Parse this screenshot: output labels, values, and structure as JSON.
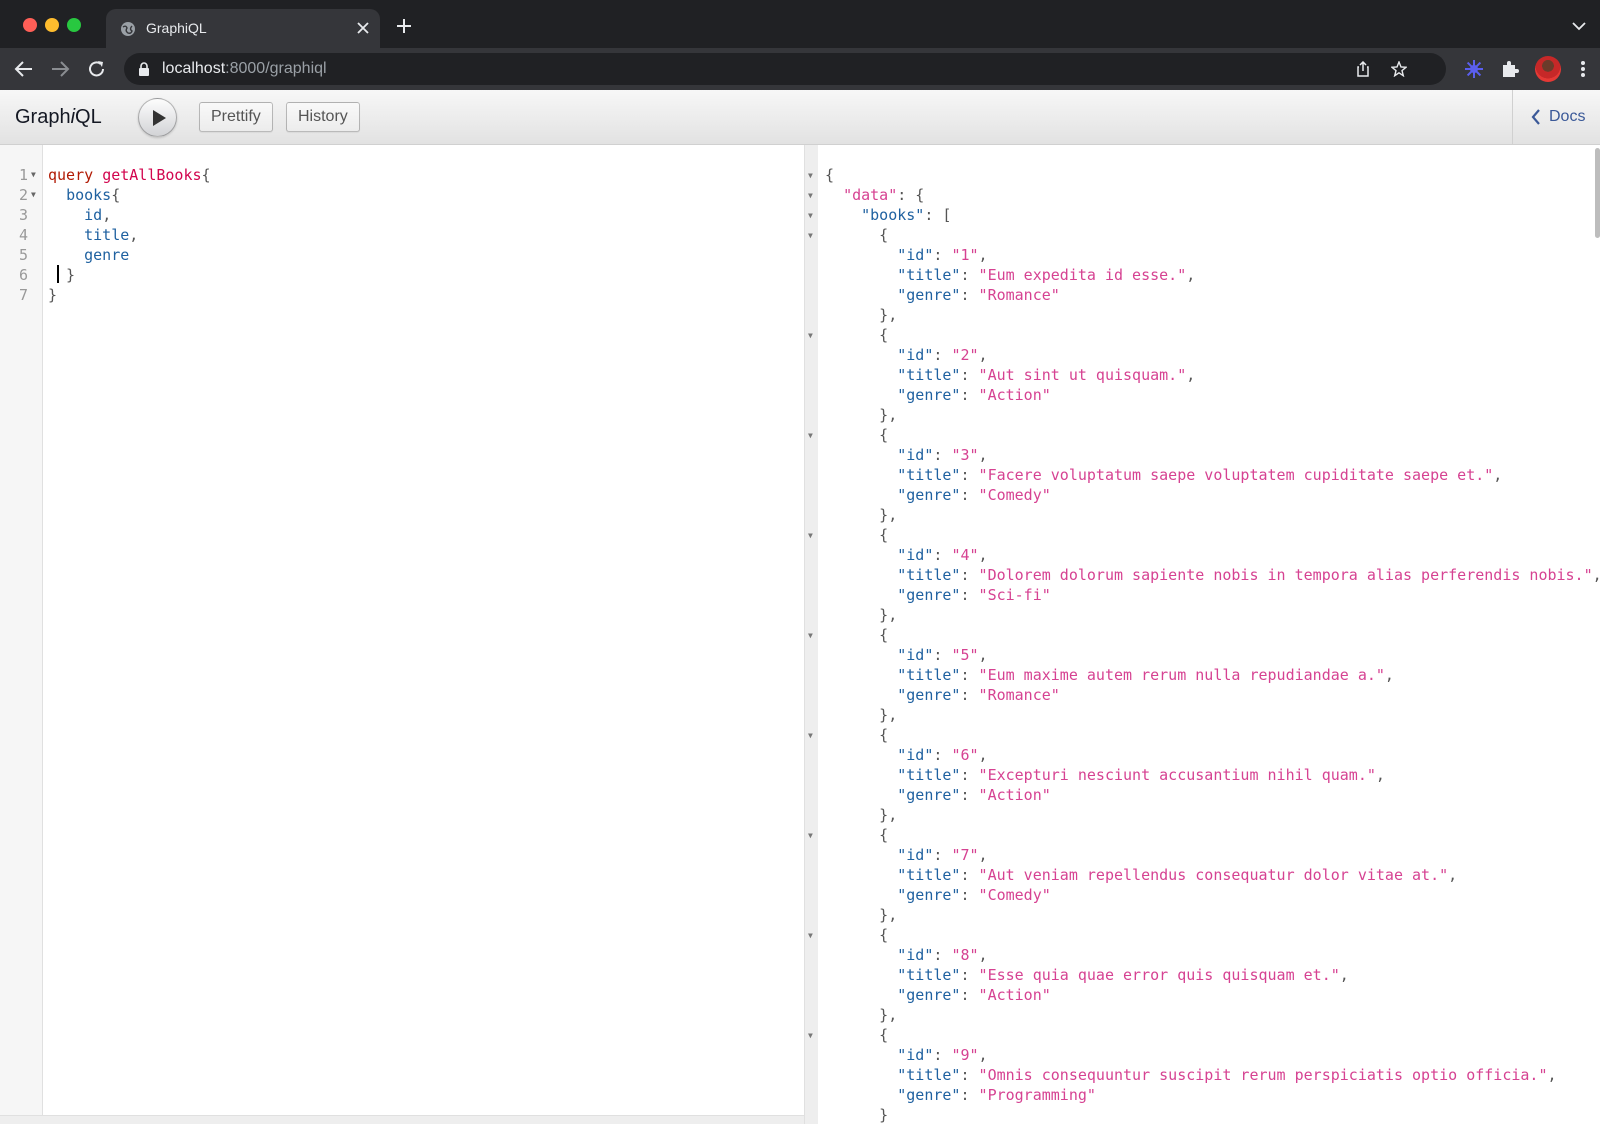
{
  "browser": {
    "tab_title": "GraphiQL",
    "url_host": "localhost",
    "url_path": ":8000/graphiql"
  },
  "graphiql": {
    "title": "GraphiQL",
    "prettify_label": "Prettify",
    "history_label": "History",
    "docs_label": "Docs"
  },
  "editor": {
    "lines": [
      {
        "n": "1",
        "fold": true,
        "parts": [
          [
            "kw",
            "query"
          ],
          [
            "pun",
            " "
          ],
          [
            "def",
            "getAllBooks"
          ],
          [
            "pun",
            "{"
          ]
        ]
      },
      {
        "n": "2",
        "fold": true,
        "parts": [
          [
            "pun",
            "  "
          ],
          [
            "prop",
            "books"
          ],
          [
            "pun",
            "{"
          ]
        ]
      },
      {
        "n": "3",
        "fold": false,
        "parts": [
          [
            "pun",
            "    "
          ],
          [
            "prop",
            "id"
          ],
          [
            "pun",
            ","
          ]
        ]
      },
      {
        "n": "4",
        "fold": false,
        "parts": [
          [
            "pun",
            "    "
          ],
          [
            "prop",
            "title"
          ],
          [
            "pun",
            ","
          ]
        ]
      },
      {
        "n": "5",
        "fold": false,
        "parts": [
          [
            "pun",
            "    "
          ],
          [
            "prop",
            "genre"
          ]
        ]
      },
      {
        "n": "6",
        "fold": false,
        "parts": [
          [
            "pun",
            "  }"
          ]
        ]
      },
      {
        "n": "7",
        "fold": false,
        "parts": [
          [
            "pun",
            "}"
          ]
        ]
      }
    ]
  },
  "result": {
    "books": [
      {
        "id": "1",
        "title": "Eum expedita id esse.",
        "genre": "Romance"
      },
      {
        "id": "2",
        "title": "Aut sint ut quisquam.",
        "genre": "Action"
      },
      {
        "id": "3",
        "title": "Facere voluptatum saepe voluptatem cupiditate saepe et.",
        "genre": "Comedy"
      },
      {
        "id": "4",
        "title": "Dolorem dolorum sapiente nobis in tempora alias perferendis nobis.",
        "genre": "Sci-fi"
      },
      {
        "id": "5",
        "title": "Eum maxime autem rerum nulla repudiandae a.",
        "genre": "Romance"
      },
      {
        "id": "6",
        "title": "Excepturi nesciunt accusantium nihil quam.",
        "genre": "Action"
      },
      {
        "id": "7",
        "title": "Aut veniam repellendus consequatur dolor vitae at.",
        "genre": "Comedy"
      },
      {
        "id": "8",
        "title": "Esse quia quae error quis quisquam et.",
        "genre": "Action"
      },
      {
        "id": "9",
        "title": "Omnis consequuntur suscipit rerum perspiciatis optio officia.",
        "genre": "Programming"
      }
    ]
  }
}
